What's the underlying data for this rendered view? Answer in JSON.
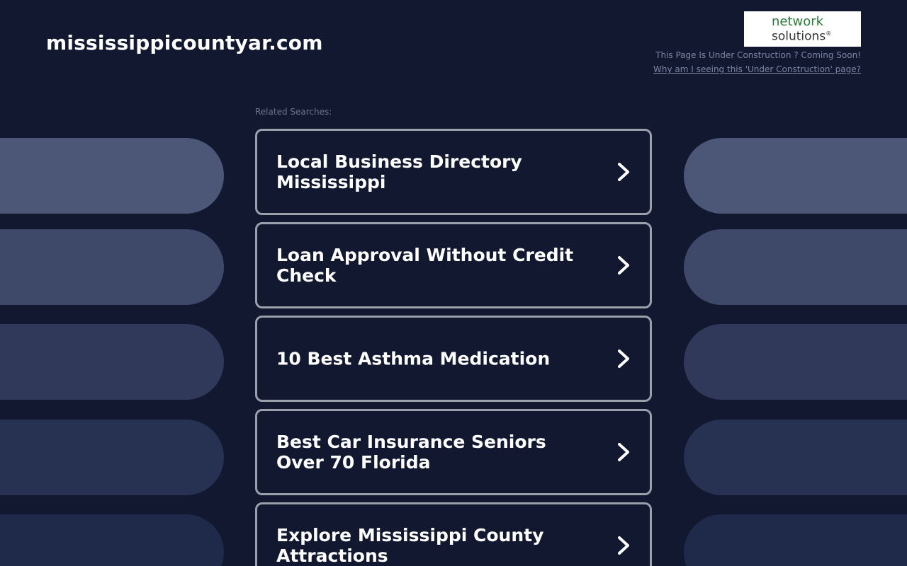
{
  "header": {
    "site_title": "mississippicountyar.com",
    "logo": {
      "line1": "network",
      "line2": "solutions",
      "registered_mark": "®"
    },
    "under_construction_text": "This Page Is Under Construction ? Coming Soon!",
    "why_link_text": "Why am I seeing this 'Under Construction' page?"
  },
  "related": {
    "label": "Related Searches:",
    "items": [
      {
        "label": "Local Business Directory Mississippi"
      },
      {
        "label": "Loan Approval Without Credit Check"
      },
      {
        "label": "10 Best Asthma Medication"
      },
      {
        "label": "Best Car Insurance Seniors Over 70 Florida"
      },
      {
        "label": "Explore Mississippi County Attractions"
      }
    ]
  },
  "decor": {
    "pill_colors": [
      "#4c5676",
      "#3e4868",
      "#30395a",
      "#273253",
      "#1f2a4a"
    ]
  },
  "colors": {
    "background": "#111830",
    "card_border": "#9aa0ab",
    "text": "#ffffff",
    "muted_text": "#7c86a3",
    "logo_green": "#2c7a3a"
  }
}
